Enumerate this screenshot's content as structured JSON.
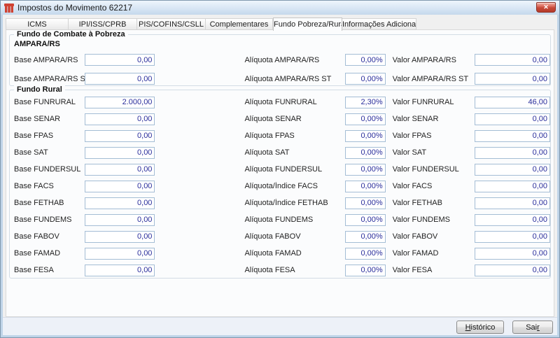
{
  "window": {
    "title": "Impostos do Movimento 62217",
    "close_glyph": "✕"
  },
  "tabs": [
    {
      "label": "ICMS",
      "active": false
    },
    {
      "label": "IPI/ISS/CPRB",
      "active": false
    },
    {
      "label": "PIS/COFINS/CSLL",
      "active": false
    },
    {
      "label": "Complementares",
      "active": false
    },
    {
      "label": "Fundo Pobreza/Rural",
      "active": true
    },
    {
      "label": "Informações Adicionais",
      "active": false
    }
  ],
  "pobreza": {
    "title": "Fundo de Combate à Pobreza",
    "subtitle": "AMPARA/RS",
    "rows": [
      {
        "base_label": "Base AMPARA/RS",
        "base_value": "0,00",
        "aliquota_label": "Alíquota AMPARA/RS",
        "aliquota_value": "0,00%",
        "valor_label": "Valor AMPARA/RS",
        "valor_value": "0,00"
      },
      {
        "base_label": "Base AMPARA/RS ST",
        "base_value": "0,00",
        "aliquota_label": "Alíquota AMPARA/RS ST",
        "aliquota_value": "0,00%",
        "valor_label": "Valor AMPARA/RS ST",
        "valor_value": "0,00"
      }
    ]
  },
  "rural": {
    "title": "Fundo Rural",
    "rows": [
      {
        "base_label": "Base FUNRURAL",
        "base_value": "2.000,00",
        "aliquota_label": "Alíquota FUNRURAL",
        "aliquota_value": "2,30%",
        "valor_label": "Valor FUNRURAL",
        "valor_value": "46,00"
      },
      {
        "base_label": "Base SENAR",
        "base_value": "0,00",
        "aliquota_label": "Alíquota SENAR",
        "aliquota_value": "0,00%",
        "valor_label": "Valor SENAR",
        "valor_value": "0,00"
      },
      {
        "base_label": "Base FPAS",
        "base_value": "0,00",
        "aliquota_label": "Alíquota FPAS",
        "aliquota_value": "0,00%",
        "valor_label": "Valor FPAS",
        "valor_value": "0,00"
      },
      {
        "base_label": "Base SAT",
        "base_value": "0,00",
        "aliquota_label": "Alíquota SAT",
        "aliquota_value": "0,00%",
        "valor_label": "Valor SAT",
        "valor_value": "0,00"
      },
      {
        "base_label": "Base FUNDERSUL",
        "base_value": "0,00",
        "aliquota_label": "Alíquota FUNDERSUL",
        "aliquota_value": "0,00%",
        "valor_label": "Valor FUNDERSUL",
        "valor_value": "0,00"
      },
      {
        "base_label": "Base FACS",
        "base_value": "0,00",
        "aliquota_label": "Alíquota/Índice FACS",
        "aliquota_value": "0,00%",
        "valor_label": "Valor FACS",
        "valor_value": "0,00"
      },
      {
        "base_label": "Base FETHAB",
        "base_value": "0,00",
        "aliquota_label": "Alíquota/Índice FETHAB",
        "aliquota_value": "0,00%",
        "valor_label": "Valor FETHAB",
        "valor_value": "0,00"
      },
      {
        "base_label": "Base FUNDEMS",
        "base_value": "0,00",
        "aliquota_label": "Alíquota FUNDEMS",
        "aliquota_value": "0,00%",
        "valor_label": "Valor FUNDEMS",
        "valor_value": "0,00"
      },
      {
        "base_label": "Base FABOV",
        "base_value": "0,00",
        "aliquota_label": "Alíquota FABOV",
        "aliquota_value": "0,00%",
        "valor_label": "Valor FABOV",
        "valor_value": "0,00"
      },
      {
        "base_label": "Base FAMAD",
        "base_value": "0,00",
        "aliquota_label": "Alíquota FAMAD",
        "aliquota_value": "0,00%",
        "valor_label": "Valor FAMAD",
        "valor_value": "0,00"
      },
      {
        "base_label": "Base FESA",
        "base_value": "0,00",
        "aliquota_label": "Alíquota FESA",
        "aliquota_value": "0,00%",
        "valor_label": "Valor FESA",
        "valor_value": "0,00"
      }
    ]
  },
  "footer": {
    "historico": {
      "accel": "H",
      "post": "istórico"
    },
    "sair": {
      "pre": "Sai",
      "accel": "r"
    }
  },
  "colors": {
    "value_text": "#292d9b",
    "frame": "#bfd4e8",
    "close_button": "#c74a39",
    "app_icon_red": "#cf4232",
    "footer_bg": "#edf1f8"
  }
}
